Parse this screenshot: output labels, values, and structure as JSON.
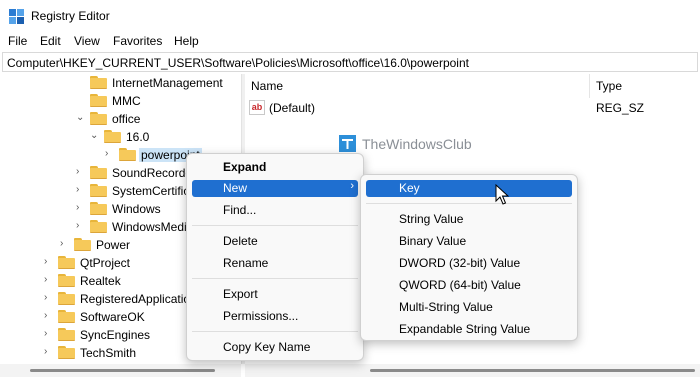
{
  "window": {
    "title": "Registry Editor"
  },
  "menu": [
    "File",
    "Edit",
    "View",
    "Favorites",
    "Help"
  ],
  "address": {
    "path": "Computer\\HKEY_CURRENT_USER\\Software\\Policies\\Microsoft\\office\\16.0\\powerpoint"
  },
  "tree": {
    "items": [
      {
        "label": "InternetManagement",
        "expanded": false
      },
      {
        "label": "MMC",
        "expanded": false
      },
      {
        "label": "office",
        "expanded": true
      },
      {
        "label": "16.0",
        "expanded": true
      },
      {
        "label": "powerpoint",
        "expanded": false,
        "selected": true
      },
      {
        "label": "SoundRecorder",
        "expanded": false
      },
      {
        "label": "SystemCertificates",
        "expanded": false
      },
      {
        "label": "Windows",
        "expanded": false
      },
      {
        "label": "WindowsMediaPlayer",
        "expanded": false
      },
      {
        "label": "Power",
        "expanded": false
      },
      {
        "label": "QtProject",
        "expanded": false
      },
      {
        "label": "Realtek",
        "expanded": false
      },
      {
        "label": "RegisteredApplications",
        "expanded": false
      },
      {
        "label": "SoftwareOK",
        "expanded": false
      },
      {
        "label": "SyncEngines",
        "expanded": false
      },
      {
        "label": "TechSmith",
        "expanded": false
      }
    ]
  },
  "list": {
    "columns": [
      "Name",
      "Type"
    ],
    "rows": [
      {
        "name": "(Default)",
        "type": "REG_SZ",
        "icon": "string-value-icon"
      }
    ]
  },
  "context_menu": {
    "items": [
      {
        "label": "Expand",
        "bold": true
      },
      {
        "label": "New",
        "has_submenu": true,
        "highlighted": true
      },
      {
        "label": "Find..."
      },
      {
        "label": "Delete"
      },
      {
        "label": "Rename"
      },
      {
        "label": "Export"
      },
      {
        "label": "Permissions..."
      },
      {
        "label": "Copy Key Name"
      }
    ]
  },
  "submenu": {
    "items": [
      {
        "label": "Key",
        "highlighted": true
      },
      {
        "label": "String Value"
      },
      {
        "label": "Binary Value"
      },
      {
        "label": "DWORD (32-bit) Value"
      },
      {
        "label": "QWORD (64-bit) Value"
      },
      {
        "label": "Multi-String Value"
      },
      {
        "label": "Expandable String Value"
      }
    ]
  },
  "watermark": {
    "text": "TheWindowsClub"
  },
  "colors": {
    "highlight": "#1f6fd0",
    "selected_bg": "#cce4f7",
    "folder": "#f6c95a"
  }
}
